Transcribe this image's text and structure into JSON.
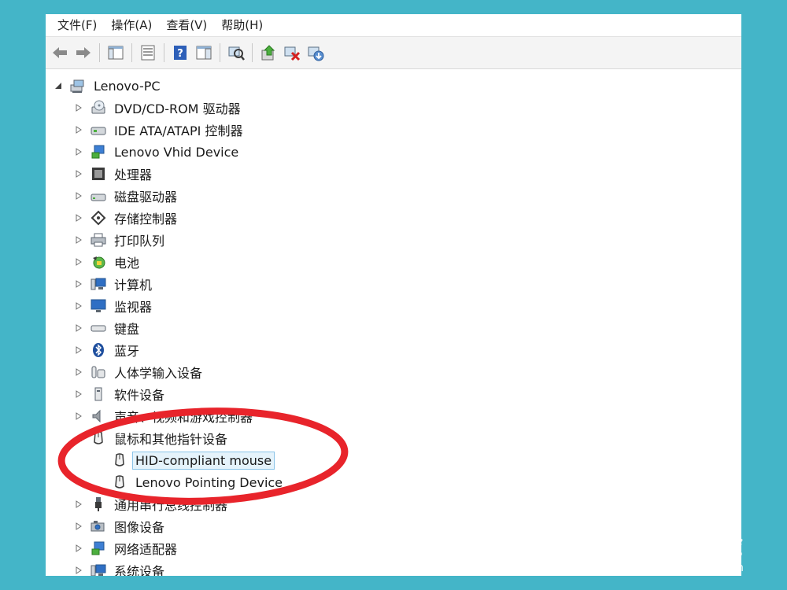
{
  "menubar": {
    "items": [
      "文件(F)",
      "操作(A)",
      "查看(V)",
      "帮助(H)"
    ]
  },
  "toolbar": {
    "buttons": [
      "back-icon",
      "forward-icon",
      "console-tree-icon",
      "properties-icon",
      "help-icon",
      "action-pane-icon",
      "scan-hardware-icon",
      "update-driver-icon",
      "disable-device-icon",
      "uninstall-device-icon"
    ]
  },
  "tree": {
    "root": {
      "label": "Lenovo-PC",
      "icon": "computer-icon",
      "expanded": true
    },
    "categories": [
      {
        "label": "DVD/CD-ROM 驱动器",
        "icon": "dvd-icon"
      },
      {
        "label": "IDE ATA/ATAPI 控制器",
        "icon": "ide-controller-icon"
      },
      {
        "label": "Lenovo Vhid Device",
        "icon": "hid-device-icon"
      },
      {
        "label": "处理器",
        "icon": "processor-icon"
      },
      {
        "label": "磁盘驱动器",
        "icon": "disk-drive-icon"
      },
      {
        "label": "存储控制器",
        "icon": "storage-controller-icon"
      },
      {
        "label": "打印队列",
        "icon": "printer-icon"
      },
      {
        "label": "电池",
        "icon": "battery-icon"
      },
      {
        "label": "计算机",
        "icon": "computer-icon"
      },
      {
        "label": "监视器",
        "icon": "monitor-icon"
      },
      {
        "label": "键盘",
        "icon": "keyboard-icon"
      },
      {
        "label": "蓝牙",
        "icon": "bluetooth-icon"
      },
      {
        "label": "人体学输入设备",
        "icon": "human-interface-icon"
      },
      {
        "label": "软件设备",
        "icon": "software-device-icon"
      },
      {
        "label": "声音、视频和游戏控制器",
        "icon": "sound-icon"
      },
      {
        "label": "鼠标和其他指针设备",
        "icon": "mouse-icon",
        "expanded": true,
        "children": [
          {
            "label": "HID-compliant mouse",
            "icon": "mouse-icon",
            "selected": true
          },
          {
            "label": "Lenovo Pointing Device",
            "icon": "mouse-icon"
          }
        ]
      },
      {
        "label": "通用串行总线控制器",
        "icon": "usb-icon"
      },
      {
        "label": "图像设备",
        "icon": "camera-icon"
      },
      {
        "label": "网络适配器",
        "icon": "network-adapter-icon"
      },
      {
        "label": "系统设备",
        "icon": "system-device-icon"
      }
    ]
  },
  "annotation": {
    "color": "#e8242b",
    "shape": "ellipse-highlight"
  },
  "watermark": {
    "main": "Bai du 经验",
    "sub": "jingyan.baidu.com"
  },
  "colors": {
    "background": "#44b5c8",
    "selection": "#e5f3fb",
    "selection_border": "#8ac4e8"
  }
}
